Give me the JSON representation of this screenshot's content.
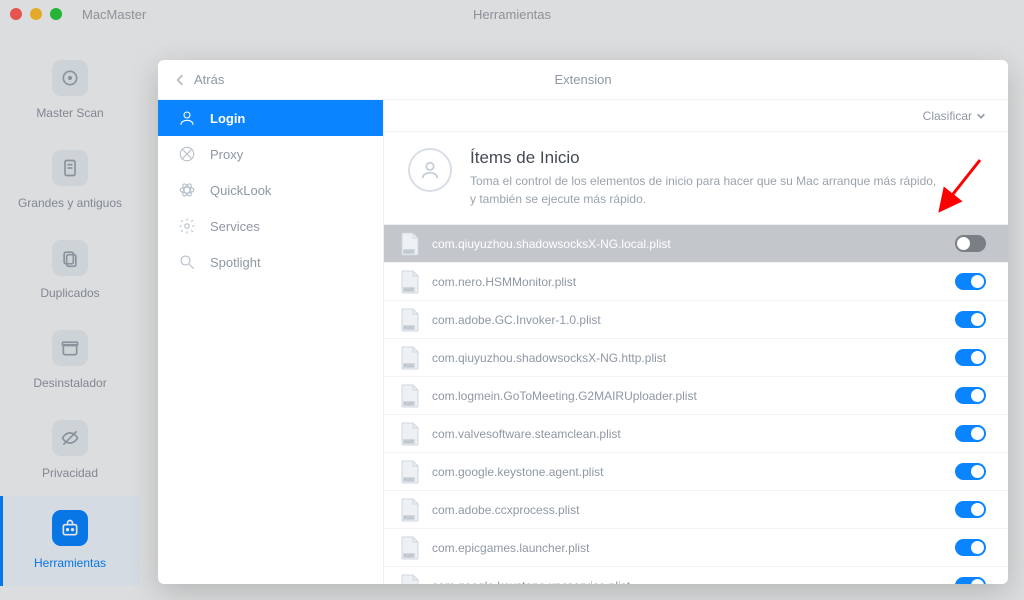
{
  "titlebar": {
    "app_name": "MacMaster",
    "window_title": "Herramientas"
  },
  "sidebar": {
    "items": [
      {
        "id": "master-scan",
        "label": "Master Scan",
        "icon": "target"
      },
      {
        "id": "grandes",
        "label": "Grandes y antiguos",
        "icon": "doc"
      },
      {
        "id": "duplicados",
        "label": "Duplicados",
        "icon": "stack"
      },
      {
        "id": "desinstalador",
        "label": "Desinstalador",
        "icon": "archive"
      },
      {
        "id": "privacidad",
        "label": "Privacidad",
        "icon": "eye-off"
      },
      {
        "id": "herramientas",
        "label": "Herramientas",
        "icon": "toolbox"
      }
    ],
    "active": "herramientas"
  },
  "modal": {
    "back_label": "Atrás",
    "header_title": "Extension",
    "sort_label": "Clasificar",
    "categories": [
      {
        "id": "login",
        "label": "Login",
        "icon": "user"
      },
      {
        "id": "proxy",
        "label": "Proxy",
        "icon": "crossed"
      },
      {
        "id": "quicklook",
        "label": "QuickLook",
        "icon": "atom"
      },
      {
        "id": "services",
        "label": "Services",
        "icon": "gear"
      },
      {
        "id": "spotlight",
        "label": "Spotlight",
        "icon": "search"
      }
    ],
    "active_category": "login",
    "section": {
      "title": "Ítems de Inicio",
      "desc": "Toma el control de los elementos de inicio para hacer que su Mac arranque más rápido, y también se ejecute más rápido."
    },
    "items": [
      {
        "name": "com.qiuyuzhou.shadowsocksX-NG.local.plist",
        "enabled": false,
        "selected": true
      },
      {
        "name": "com.nero.HSMMonitor.plist",
        "enabled": true,
        "selected": false
      },
      {
        "name": "com.adobe.GC.Invoker-1.0.plist",
        "enabled": true,
        "selected": false
      },
      {
        "name": "com.qiuyuzhou.shadowsocksX-NG.http.plist",
        "enabled": true,
        "selected": false
      },
      {
        "name": "com.logmein.GoToMeeting.G2MAIRUploader.plist",
        "enabled": true,
        "selected": false
      },
      {
        "name": "com.valvesoftware.steamclean.plist",
        "enabled": true,
        "selected": false
      },
      {
        "name": "com.google.keystone.agent.plist",
        "enabled": true,
        "selected": false
      },
      {
        "name": "com.adobe.ccxprocess.plist",
        "enabled": true,
        "selected": false
      },
      {
        "name": "com.epicgames.launcher.plist",
        "enabled": true,
        "selected": false
      },
      {
        "name": "com.google.keystone.xpcservice.plist",
        "enabled": true,
        "selected": false
      }
    ]
  }
}
